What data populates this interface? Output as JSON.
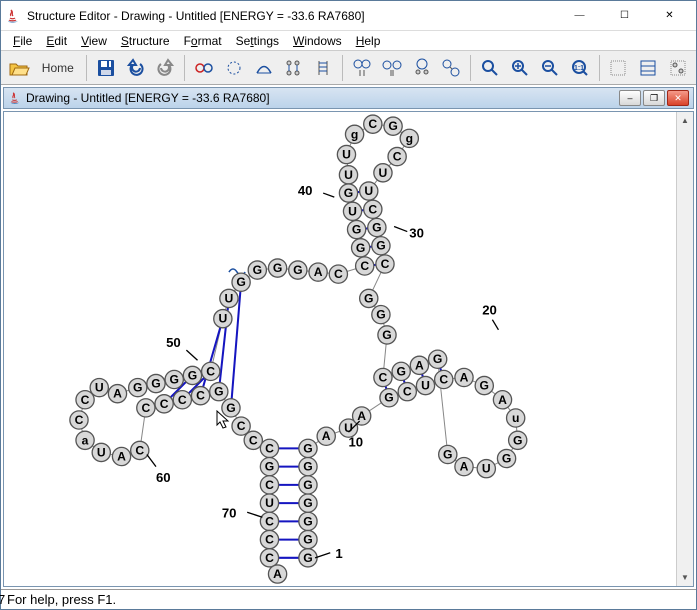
{
  "window": {
    "title": "Structure Editor - Drawing - Untitled [ENERGY = -33.6  RA7680]"
  },
  "menus": {
    "file": "File",
    "edit": "Edit",
    "view": "View",
    "structure": "Structure",
    "format": "Format",
    "settings": "Settings",
    "windows": "Windows",
    "help": "Help"
  },
  "toolbar": {
    "home": "Home"
  },
  "inner": {
    "title": "Drawing - Untitled [ENERGY = -33.6  RA7680]"
  },
  "status": {
    "text": "For help, press F1.",
    "left_fragment": "7"
  },
  "labels": {
    "n1": "1",
    "n10": "10",
    "n20": "20",
    "n30": "30",
    "n40": "40",
    "n50": "50",
    "n60": "60",
    "n70": "70"
  },
  "chart_data": {
    "type": "diagram",
    "description": "RNA secondary structure layout",
    "energy": -33.6,
    "id": "RA7680",
    "annotated_positions": [
      1,
      10,
      20,
      30,
      40,
      50,
      60,
      70
    ],
    "highlighted_residue": {
      "label": "G",
      "color": "#20d030"
    }
  }
}
